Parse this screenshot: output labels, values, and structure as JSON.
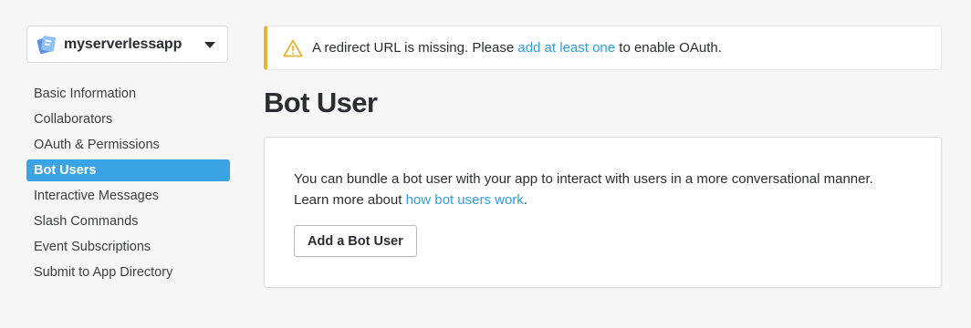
{
  "sidebar": {
    "app_name": "myserverlessapp",
    "items": [
      {
        "label": "Basic Information",
        "active": false
      },
      {
        "label": "Collaborators",
        "active": false
      },
      {
        "label": "OAuth & Permissions",
        "active": false
      },
      {
        "label": "Bot Users",
        "active": true
      },
      {
        "label": "Interactive Messages",
        "active": false
      },
      {
        "label": "Slash Commands",
        "active": false
      },
      {
        "label": "Event Subscriptions",
        "active": false
      },
      {
        "label": "Submit to App Directory",
        "active": false
      }
    ]
  },
  "alert": {
    "icon": "warning-icon",
    "text_before": "A redirect URL is missing. Please ",
    "link_text": "add at least one",
    "text_after": " to enable OAuth."
  },
  "page": {
    "title": "Bot User"
  },
  "card": {
    "line1": "You can bundle a bot user with your app to interact with users in a more conversational manner.",
    "line2_before": "Learn more about ",
    "link_text": "how bot users work",
    "line2_after": ".",
    "button_label": "Add a Bot User"
  },
  "colors": {
    "accent": "#3aa3e3",
    "link": "#2d9ee0",
    "warning": "#e8b33a",
    "background": "#f7f7f7"
  }
}
